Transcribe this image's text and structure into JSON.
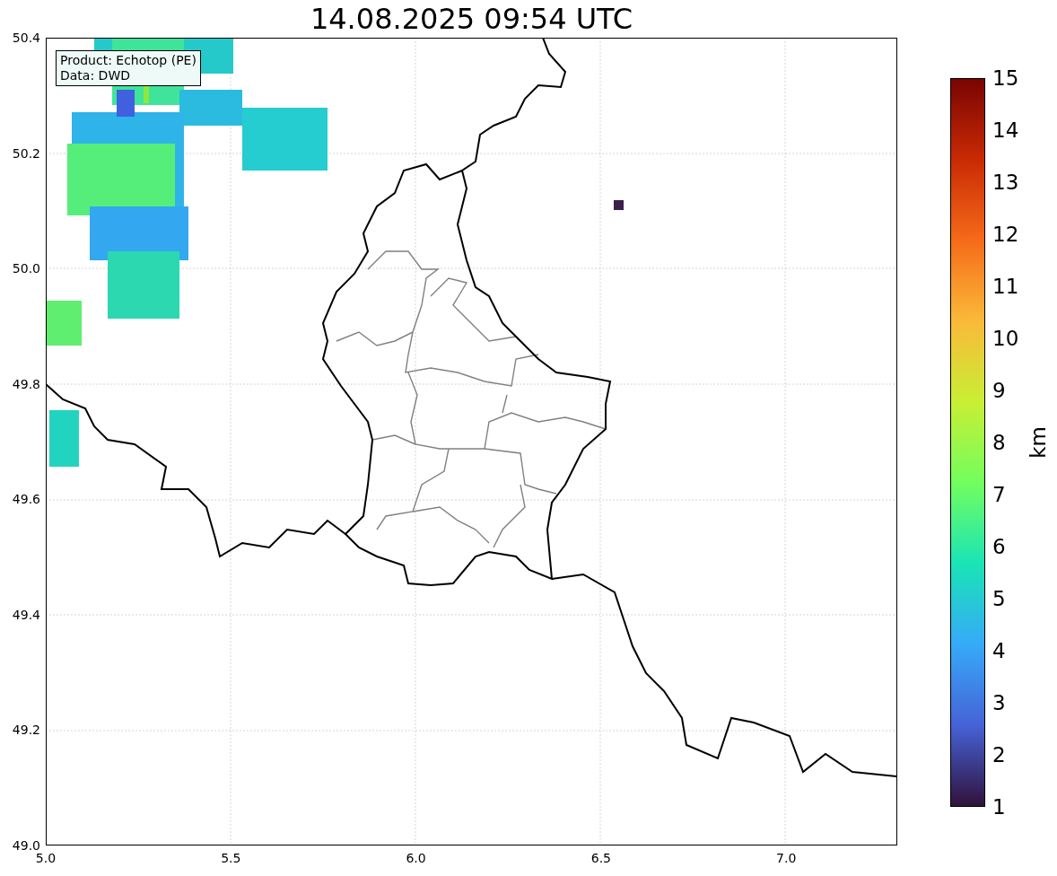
{
  "title": "14.08.2025 09:54 UTC",
  "annotation": {
    "lines": [
      "Product: Echotop (PE)",
      "Data: DWD"
    ]
  },
  "map": {
    "y_ticks": [
      "50.4",
      "50.2",
      "50.0",
      "49.8",
      "49.6",
      "49.4",
      "49.2",
      "49.0"
    ],
    "x_ticks": [
      "5.0",
      "5.5",
      "6.0",
      "6.5",
      "7.0"
    ]
  },
  "colorbar": {
    "label": "km",
    "ticks": [
      "15",
      "14",
      "13",
      "12",
      "11",
      "10",
      "9",
      "8",
      "7",
      "6",
      "5",
      "4",
      "3",
      "2",
      "1"
    ]
  }
}
